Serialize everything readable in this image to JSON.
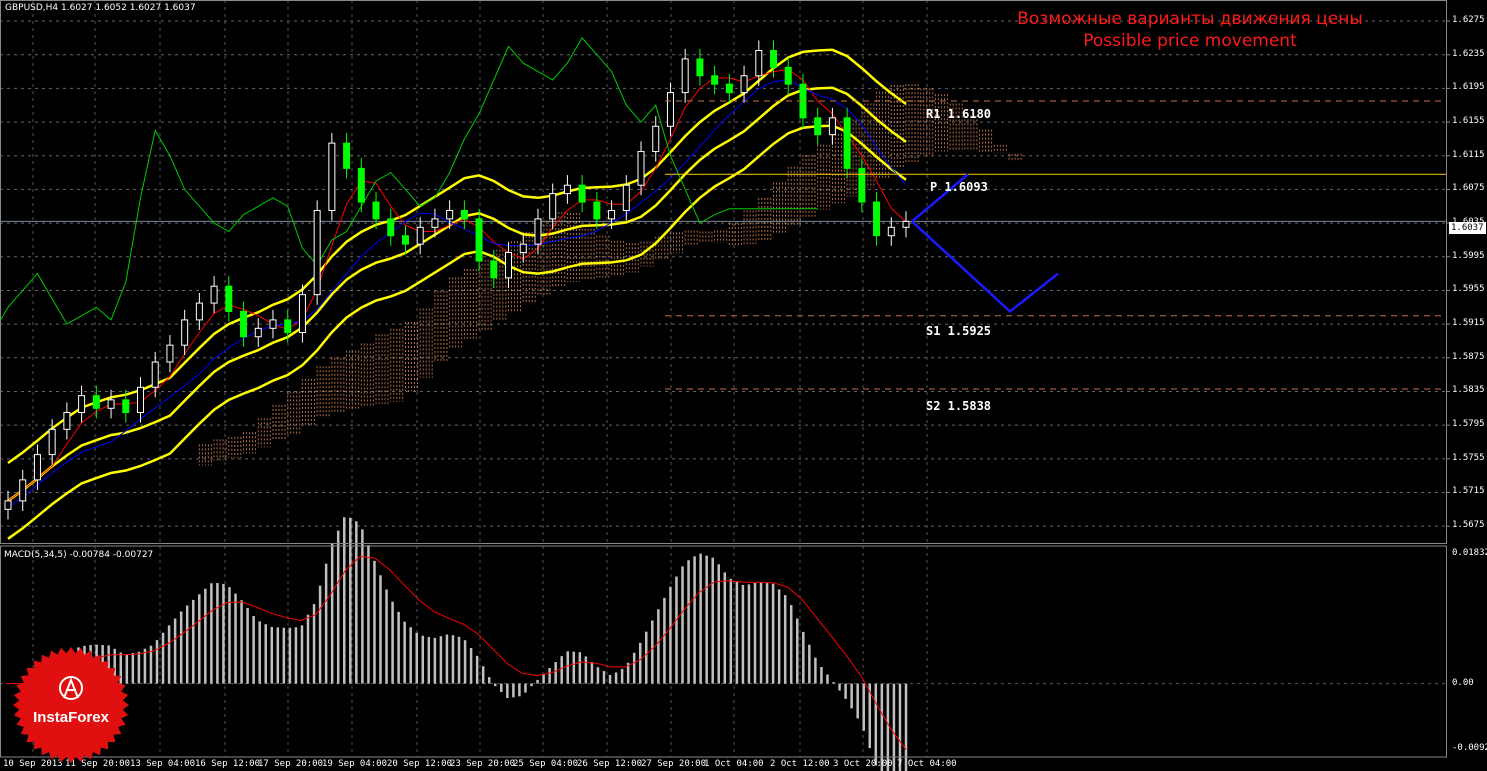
{
  "header": {
    "symbol_info": "GBPUSD,H4  1.6027 1.6052 1.6027 1.6037"
  },
  "annotation": {
    "line1": "Возможные варианты движения цены",
    "line2": "Possible price movement"
  },
  "levels": {
    "r1": "R1 1.6180",
    "p": "P 1.6093",
    "s1": "S1 1.5925",
    "s2": "S2 1.5838"
  },
  "price_axis": {
    "ticks": [
      "1.6275",
      "1.6235",
      "1.6195",
      "1.6155",
      "1.6115",
      "1.6075",
      "1.6035",
      "1.5995",
      "1.5955",
      "1.5915",
      "1.5875",
      "1.5835",
      "1.5795",
      "1.5755",
      "1.5715",
      "1.5675"
    ],
    "current": "1.6037"
  },
  "time_axis": [
    "10 Sep 2013",
    "11 Sep 20:00",
    "13 Sep 04:00",
    "16 Sep 12:00",
    "17 Sep 20:00",
    "19 Sep 04:00",
    "20 Sep 12:00",
    "23 Sep 20:00",
    "25 Sep 04:00",
    "26 Sep 12:00",
    "27 Sep 20:00",
    "1 Oct 04:00",
    "2 Oct 12:00",
    "3 Oct 20:00",
    "7 Oct 04:00"
  ],
  "macd": {
    "label": "MACD(5,34,5) -0.00784 -0.00727",
    "ticks": [
      "0.01832",
      "0.00",
      "-0.00925"
    ]
  },
  "logo": {
    "text": "InstaForex"
  },
  "colors": {
    "bollinger": "#ffff00",
    "tenkan": "#ff0000",
    "kijun": "#0000ff",
    "chikou": "#00cc00",
    "cloud": "#ffa066",
    "bull": "#ffffff",
    "bear": "#00ff00",
    "forecast": "#1a1aff",
    "pivot_p": "#ffcc00",
    "levels": "#c0704d",
    "macd_hist": "#c0c0c0",
    "macd_signal": "#ff0000",
    "title": "#ff1a1a"
  },
  "chart_data": {
    "type": "candlestick",
    "price_range": [
      1.5655,
      1.63
    ],
    "indicators": [
      "Bollinger Bands",
      "Ichimoku",
      "Pivot Points",
      "MACD(5,34,5)"
    ],
    "close_series": [
      1.5705,
      1.573,
      1.576,
      1.579,
      1.581,
      1.583,
      1.5815,
      1.5825,
      1.581,
      1.584,
      1.587,
      1.589,
      1.592,
      1.594,
      1.596,
      1.593,
      1.59,
      1.591,
      1.592,
      1.5905,
      1.595,
      1.605,
      1.613,
      1.61,
      1.606,
      1.604,
      1.602,
      1.601,
      1.603,
      1.604,
      1.605,
      1.604,
      1.599,
      1.597,
      1.6,
      1.601,
      1.604,
      1.607,
      1.608,
      1.606,
      1.604,
      1.605,
      1.608,
      1.612,
      1.615,
      1.619,
      1.623,
      1.621,
      1.62,
      1.619,
      1.621,
      1.624,
      1.622,
      1.62,
      1.616,
      1.614,
      1.616,
      1.61,
      1.606,
      1.602,
      1.603,
      1.6037
    ],
    "pivot_levels": {
      "R1": 1.618,
      "P": 1.6093,
      "S1": 1.5925,
      "S2": 1.5838
    },
    "forecast_up": [
      1.6037,
      1.6093
    ],
    "forecast_down": [
      1.6037,
      1.593,
      1.5975
    ],
    "macd_range": [
      -0.00925,
      0.01832
    ],
    "macd_last": {
      "main": -0.00784,
      "signal": -0.00727
    }
  }
}
